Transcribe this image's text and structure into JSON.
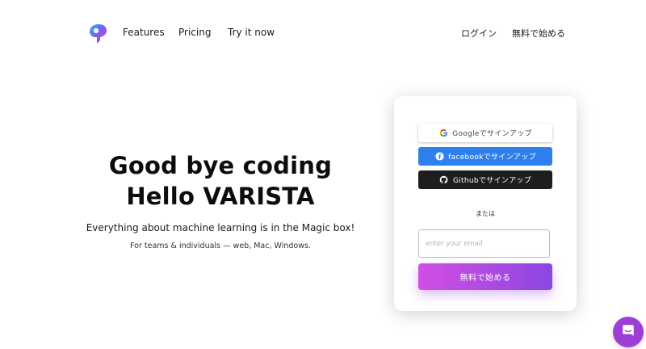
{
  "nav": {
    "links": [
      "Features",
      "Pricing",
      "Try it now"
    ],
    "login": "ログイン",
    "start": "無料で始める"
  },
  "hero": {
    "title_line1": "Good bye coding",
    "title_line2": "Hello VARISTA",
    "subtitle": "Everything about machine learning is in the Magic box!",
    "note": "For teams & individuals — web, Mac, Windows."
  },
  "signup": {
    "google_label": "Googleでサインアップ",
    "facebook_label": "facebookでサインアップ",
    "github_label": "Githubでサインアップ",
    "or": "または",
    "email_placeholder": "enter your email",
    "start_label": "無料で始める"
  },
  "colors": {
    "brand_gradient_start": "#d24fe3",
    "brand_gradient_end": "#8a47e2",
    "facebook": "#2f80ed",
    "github": "#1e1e1e",
    "chat": "#9b3fd6"
  },
  "icons": [
    "varista-logo-icon",
    "google-icon",
    "facebook-icon",
    "github-icon",
    "chat-icon"
  ]
}
